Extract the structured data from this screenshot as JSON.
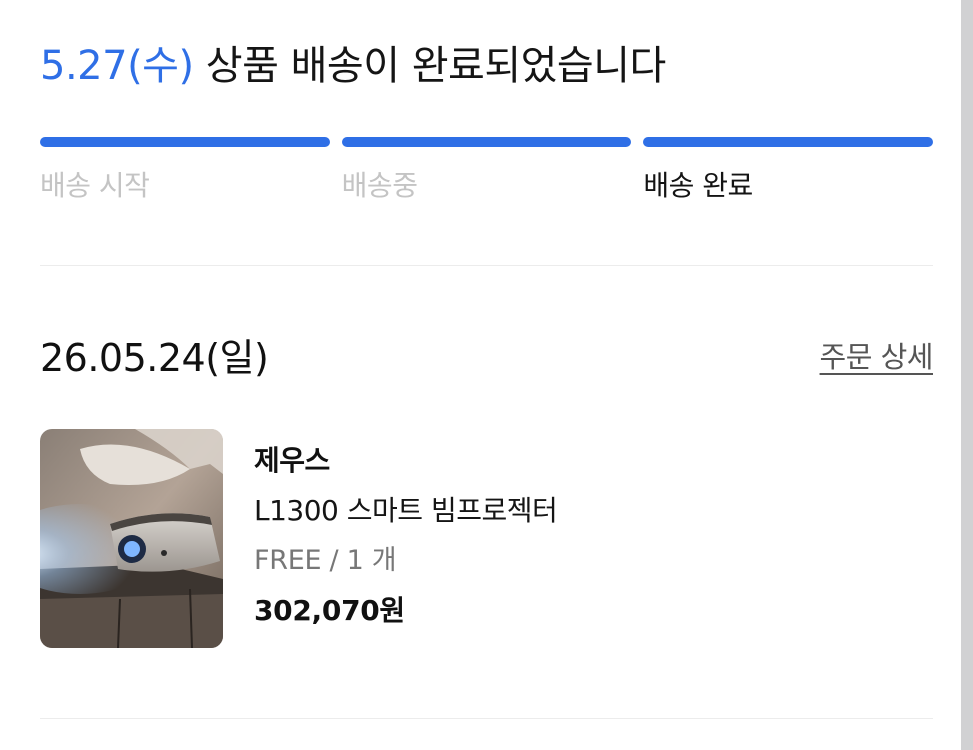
{
  "status": {
    "delivered_date": "5.27(수)",
    "message": " 상품 배송이 완료되었습니다"
  },
  "progress": {
    "steps": [
      {
        "label": "배송 시작",
        "state": "inactive"
      },
      {
        "label": "배송중",
        "state": "inactive"
      },
      {
        "label": "배송 완료",
        "state": "active"
      }
    ],
    "accent_color": "#2f6fe6"
  },
  "order": {
    "date": "26.05.24(일)",
    "detail_link": "주문 상세",
    "item": {
      "image_icon": "projector-image",
      "brand": "제우스",
      "name": "L1300 스마트 빔프로젝터",
      "option": "FREE / 1 개",
      "price": "302,070원"
    }
  }
}
